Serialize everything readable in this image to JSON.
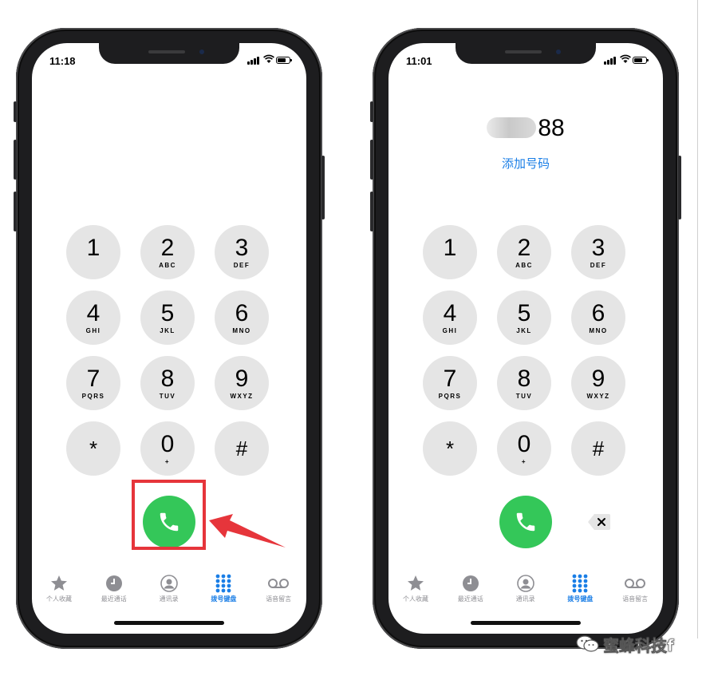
{
  "left_phone": {
    "status": {
      "time": "11:18"
    },
    "keys": [
      {
        "digit": "1",
        "letters": ""
      },
      {
        "digit": "2",
        "letters": "ABC"
      },
      {
        "digit": "3",
        "letters": "DEF"
      },
      {
        "digit": "4",
        "letters": "GHI"
      },
      {
        "digit": "5",
        "letters": "JKL"
      },
      {
        "digit": "6",
        "letters": "MNO"
      },
      {
        "digit": "7",
        "letters": "PQRS"
      },
      {
        "digit": "8",
        "letters": "TUV"
      },
      {
        "digit": "9",
        "letters": "WXYZ"
      },
      {
        "digit": "*",
        "letters": ""
      },
      {
        "digit": "0",
        "letters": "+"
      },
      {
        "digit": "#",
        "letters": ""
      }
    ],
    "tabs": [
      {
        "label": "个人收藏",
        "icon": "star-icon"
      },
      {
        "label": "最近通话",
        "icon": "clock-icon"
      },
      {
        "label": "通讯录",
        "icon": "contact-icon"
      },
      {
        "label": "拨号键盘",
        "icon": "keypad-icon",
        "active": true
      },
      {
        "label": "语音留言",
        "icon": "voicemail-icon"
      }
    ]
  },
  "right_phone": {
    "status": {
      "time": "11:01"
    },
    "dialed_number_visible": "88",
    "add_number_label": "添加号码",
    "keys": [
      {
        "digit": "1",
        "letters": ""
      },
      {
        "digit": "2",
        "letters": "ABC"
      },
      {
        "digit": "3",
        "letters": "DEF"
      },
      {
        "digit": "4",
        "letters": "GHI"
      },
      {
        "digit": "5",
        "letters": "JKL"
      },
      {
        "digit": "6",
        "letters": "MNO"
      },
      {
        "digit": "7",
        "letters": "PQRS"
      },
      {
        "digit": "8",
        "letters": "TUV"
      },
      {
        "digit": "9",
        "letters": "WXYZ"
      },
      {
        "digit": "*",
        "letters": ""
      },
      {
        "digit": "0",
        "letters": "+"
      },
      {
        "digit": "#",
        "letters": ""
      }
    ],
    "tabs": [
      {
        "label": "个人收藏",
        "icon": "star-icon"
      },
      {
        "label": "最近通话",
        "icon": "clock-icon"
      },
      {
        "label": "通讯录",
        "icon": "contact-icon"
      },
      {
        "label": "拨号键盘",
        "icon": "keypad-icon",
        "active": true
      },
      {
        "label": "语音留言",
        "icon": "voicemail-icon"
      }
    ]
  },
  "annotation": {
    "highlight_color": "#e6353b"
  },
  "colors": {
    "call_green": "#34c759",
    "accent_blue": "#1a7ee6",
    "key_gray": "#e5e5e5"
  },
  "watermark": {
    "text": "蜜蜂科技f"
  }
}
